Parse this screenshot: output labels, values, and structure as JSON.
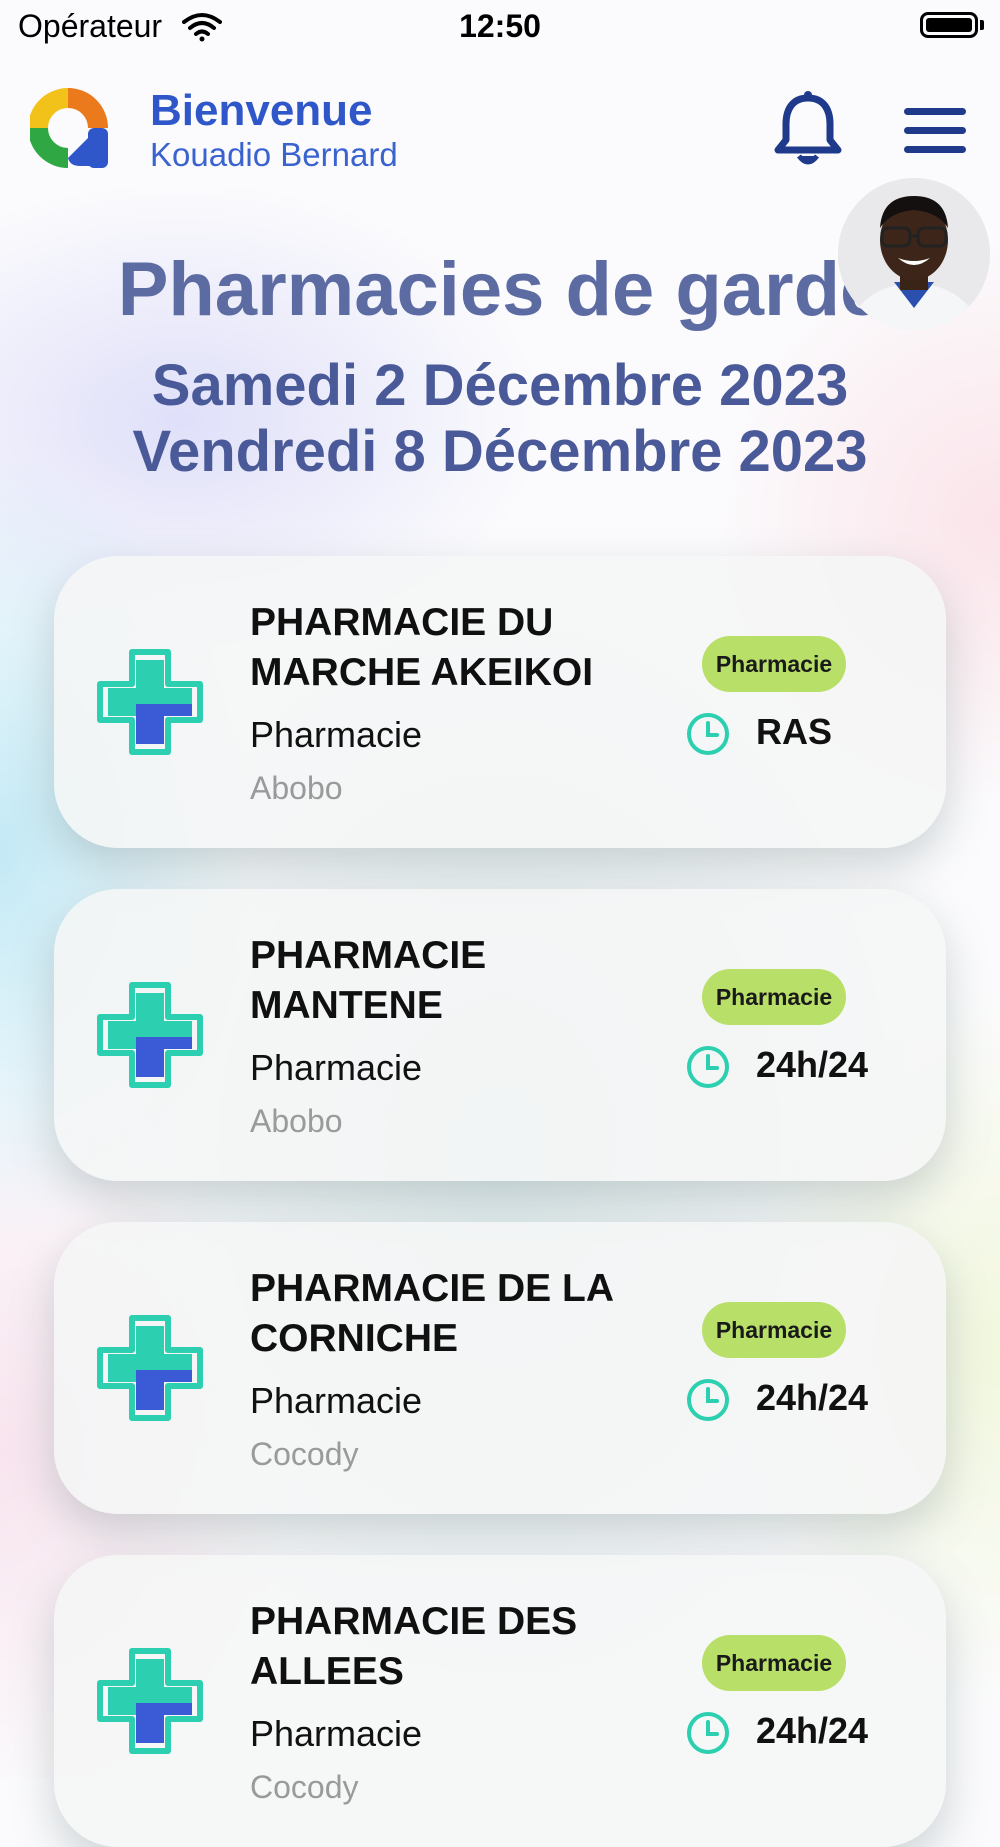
{
  "status_bar": {
    "carrier": "Opérateur",
    "time": "12:50"
  },
  "header": {
    "welcome": "Bienvenue",
    "user_name": "Kouadio Bernard"
  },
  "page": {
    "title": "Pharmacies de garde",
    "date_start": "Samedi 2 Décembre 2023",
    "date_end": "Vendredi 8 Décembre 2023"
  },
  "pharmacies": [
    {
      "name": "PHARMACIE DU MARCHE AKEIKOI",
      "type": "Pharmacie",
      "city": "Abobo",
      "badge": "Pharmacie",
      "hours": "RAS"
    },
    {
      "name": "PHARMACIE MANTENE",
      "type": "Pharmacie",
      "city": "Abobo",
      "badge": "Pharmacie",
      "hours": "24h/24"
    },
    {
      "name": "PHARMACIE DE LA CORNICHE",
      "type": "Pharmacie",
      "city": "Cocody",
      "badge": "Pharmacie",
      "hours": "24h/24"
    },
    {
      "name": "PHARMACIE DES ALLEES",
      "type": "Pharmacie",
      "city": "Cocody",
      "badge": "Pharmacie",
      "hours": "24h/24"
    }
  ],
  "colors": {
    "brand_blue": "#2f57c9",
    "title": "#5d6ba3",
    "badge_green": "#b8e068",
    "cross_teal": "#2ccfb0",
    "cross_blue": "#3b5bd6"
  },
  "icons": {
    "logo": "app-logo-icon",
    "notifications": "bell-icon",
    "menu": "hamburger-menu-icon",
    "pharmacy": "pharmacy-cross-icon",
    "hours": "clock-icon"
  }
}
